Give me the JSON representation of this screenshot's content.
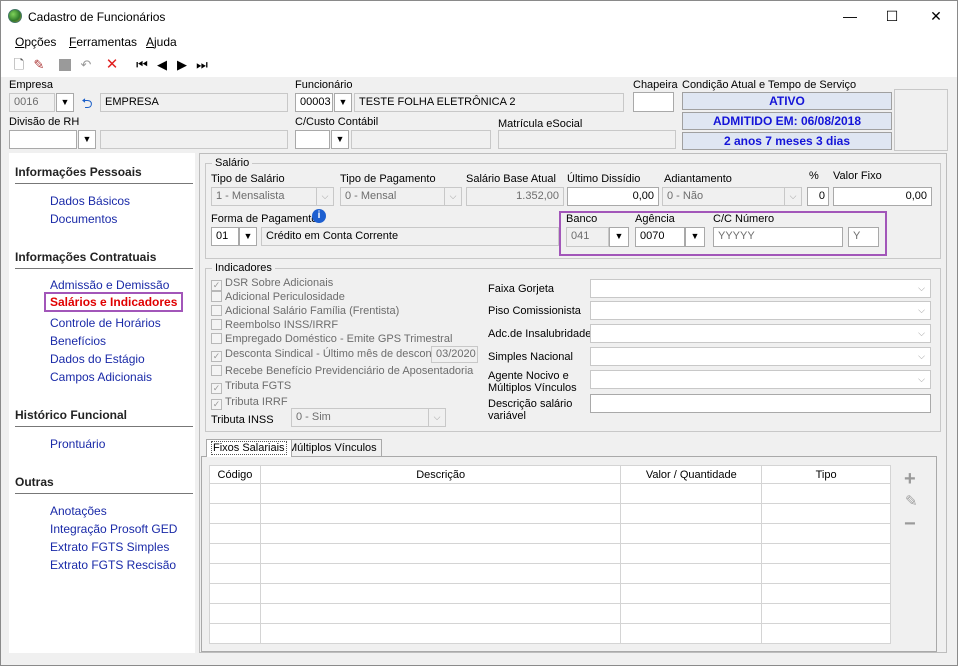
{
  "window": {
    "title": "Cadastro de Funcionários",
    "minimize": "—",
    "maximize": "☐",
    "close": "✕"
  },
  "menu": {
    "opcoes_first": "O",
    "opcoes_rest": "pções",
    "ferr_first": "F",
    "ferr_rest": "erramentas",
    "ajuda_first": "A",
    "ajuda_rest": "juda"
  },
  "header": {
    "empresa_label": "Empresa",
    "empresa_code": "0016",
    "empresa_name": "EMPRESA",
    "funcionario_label": "Funcionário",
    "funcionario_code": "00003",
    "funcionario_name": "TESTE FOLHA ELETRÔNICA 2",
    "chapeira_label": "Chapeira",
    "condicao_label": "Condição Atual e Tempo de Serviço",
    "status_ativo": "ATIVO",
    "status_admitido": "ADMITIDO EM: 06/08/2018",
    "status_tempo": "2 anos 7 meses 3 dias",
    "divisao_label": "Divisão de RH",
    "ccusto_label": "C/Custo Contábil",
    "matricula_label": "Matrícula eSocial"
  },
  "sidebar": {
    "sections": [
      {
        "title": "Informações Pessoais",
        "items": [
          "Dados Básicos",
          "Documentos"
        ]
      },
      {
        "title": "Informações Contratuais",
        "items": [
          "Admissão e Demissão",
          "Salários e Indicadores",
          "Controle de Horários",
          "Benefícios",
          "Dados do Estágio",
          "Campos Adicionais"
        ]
      },
      {
        "title": "Histórico Funcional",
        "items": [
          "Prontuário"
        ]
      },
      {
        "title": "Outras",
        "items": [
          "Anotações",
          "Integração Prosoft GED",
          "Extrato FGTS Simples",
          "Extrato FGTS Rescisão"
        ]
      }
    ]
  },
  "salario": {
    "group_label": "Salário",
    "tipo_label": "Tipo de Salário",
    "tipo_value": "1 - Mensalista",
    "pag_label": "Tipo de Pagamento",
    "pag_value": "0 - Mensal",
    "base_label": "Salário Base Atual",
    "base_value": "1.352,00",
    "dissidio_label": "Último Dissídio",
    "dissidio_value": "0,00",
    "adiant_label": "Adiantamento",
    "adiant_value": "0 - Não",
    "pct_label": "%",
    "pct_value": "0",
    "fixo_label": "Valor Fixo",
    "fixo_value": "0,00",
    "forma_label": "Forma de Pagamento",
    "forma_code": "01",
    "forma_desc": "Crédito em Conta Corrente",
    "banco_label": "Banco",
    "banco_value": "041",
    "agencia_label": "Agência",
    "agencia_value": "0070",
    "cc_label": "C/C Número",
    "cc_value": "YYYYY",
    "cc_dv": "Y"
  },
  "indicadores": {
    "group_label": "Indicadores",
    "checks": [
      {
        "label": "DSR Sobre Adicionais",
        "checked": true
      },
      {
        "label": "Adicional Periculosidade",
        "checked": false
      },
      {
        "label": "Adicional Salário Família (Frentista)",
        "checked": false
      },
      {
        "label": "Reembolso INSS/IRRF",
        "checked": false
      },
      {
        "label": "Empregado Doméstico - Emite GPS Trimestral",
        "checked": false
      },
      {
        "label": "Desconta Sindical - Último mês de desconto",
        "checked": true
      },
      {
        "label": "Recebe Benefício Previdenciário de Aposentadoria",
        "checked": false
      },
      {
        "label": "Tributa FGTS",
        "checked": true
      },
      {
        "label": "Tributa IRRF",
        "checked": true
      }
    ],
    "sindical_mes": "03/2020",
    "inss_label": "Tributa INSS",
    "inss_value": "0 - Sim",
    "faixa_label": "Faixa Gorjeta",
    "piso_label": "Piso Comissionista",
    "insal_label": "Adc.de Insalubridade",
    "simples_label": "Simples Nacional",
    "agente_label1": "Agente Nocivo e",
    "agente_label2": "Múltiplos Vínculos",
    "desc_label1": "Descrição salário",
    "desc_label2": "variável"
  },
  "tabs": {
    "fixos": "Fixos Salariais",
    "multiplos": "Múltiplos Vínculos"
  },
  "grid": {
    "columns": [
      "Código",
      "Descrição",
      "Valor / Quantidade",
      "Tipo"
    ]
  },
  "icons": {
    "add": "plus-icon",
    "edit": "pencil-icon",
    "remove": "minus-icon"
  }
}
